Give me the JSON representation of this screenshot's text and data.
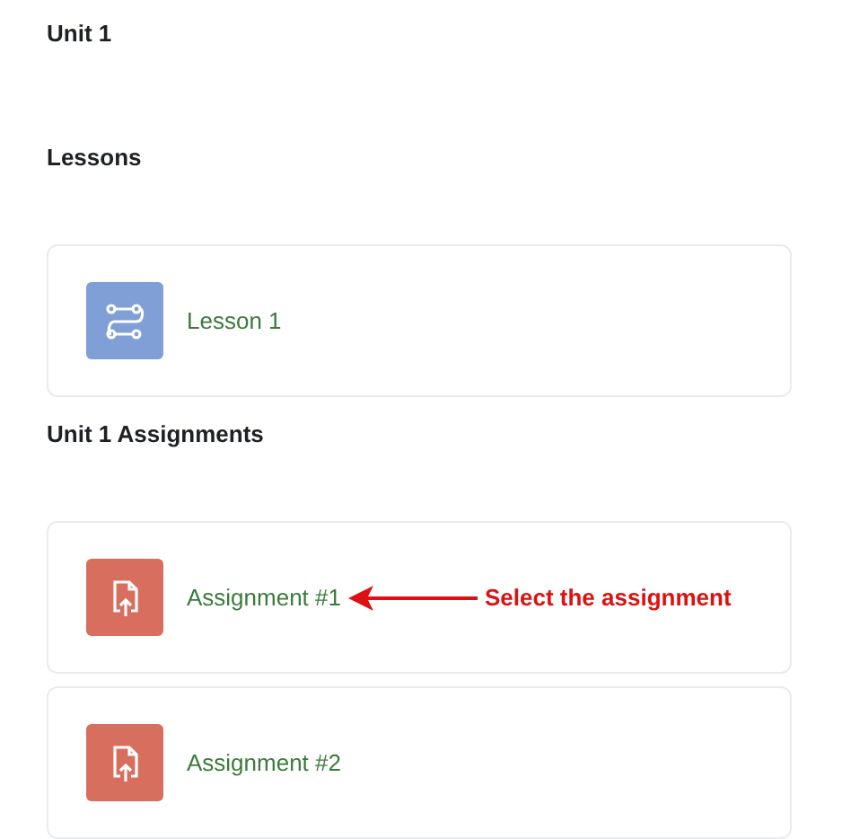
{
  "sections": [
    {
      "title": "Unit 1"
    },
    {
      "title": "Lessons",
      "items": [
        {
          "kind": "lesson",
          "label": "Lesson 1"
        }
      ]
    },
    {
      "title": "Unit 1 Assignments",
      "items": [
        {
          "kind": "assignment",
          "label": "Assignment #1",
          "annotation": "Select the assignment"
        },
        {
          "kind": "assignment",
          "label": "Assignment #2"
        }
      ]
    }
  ]
}
